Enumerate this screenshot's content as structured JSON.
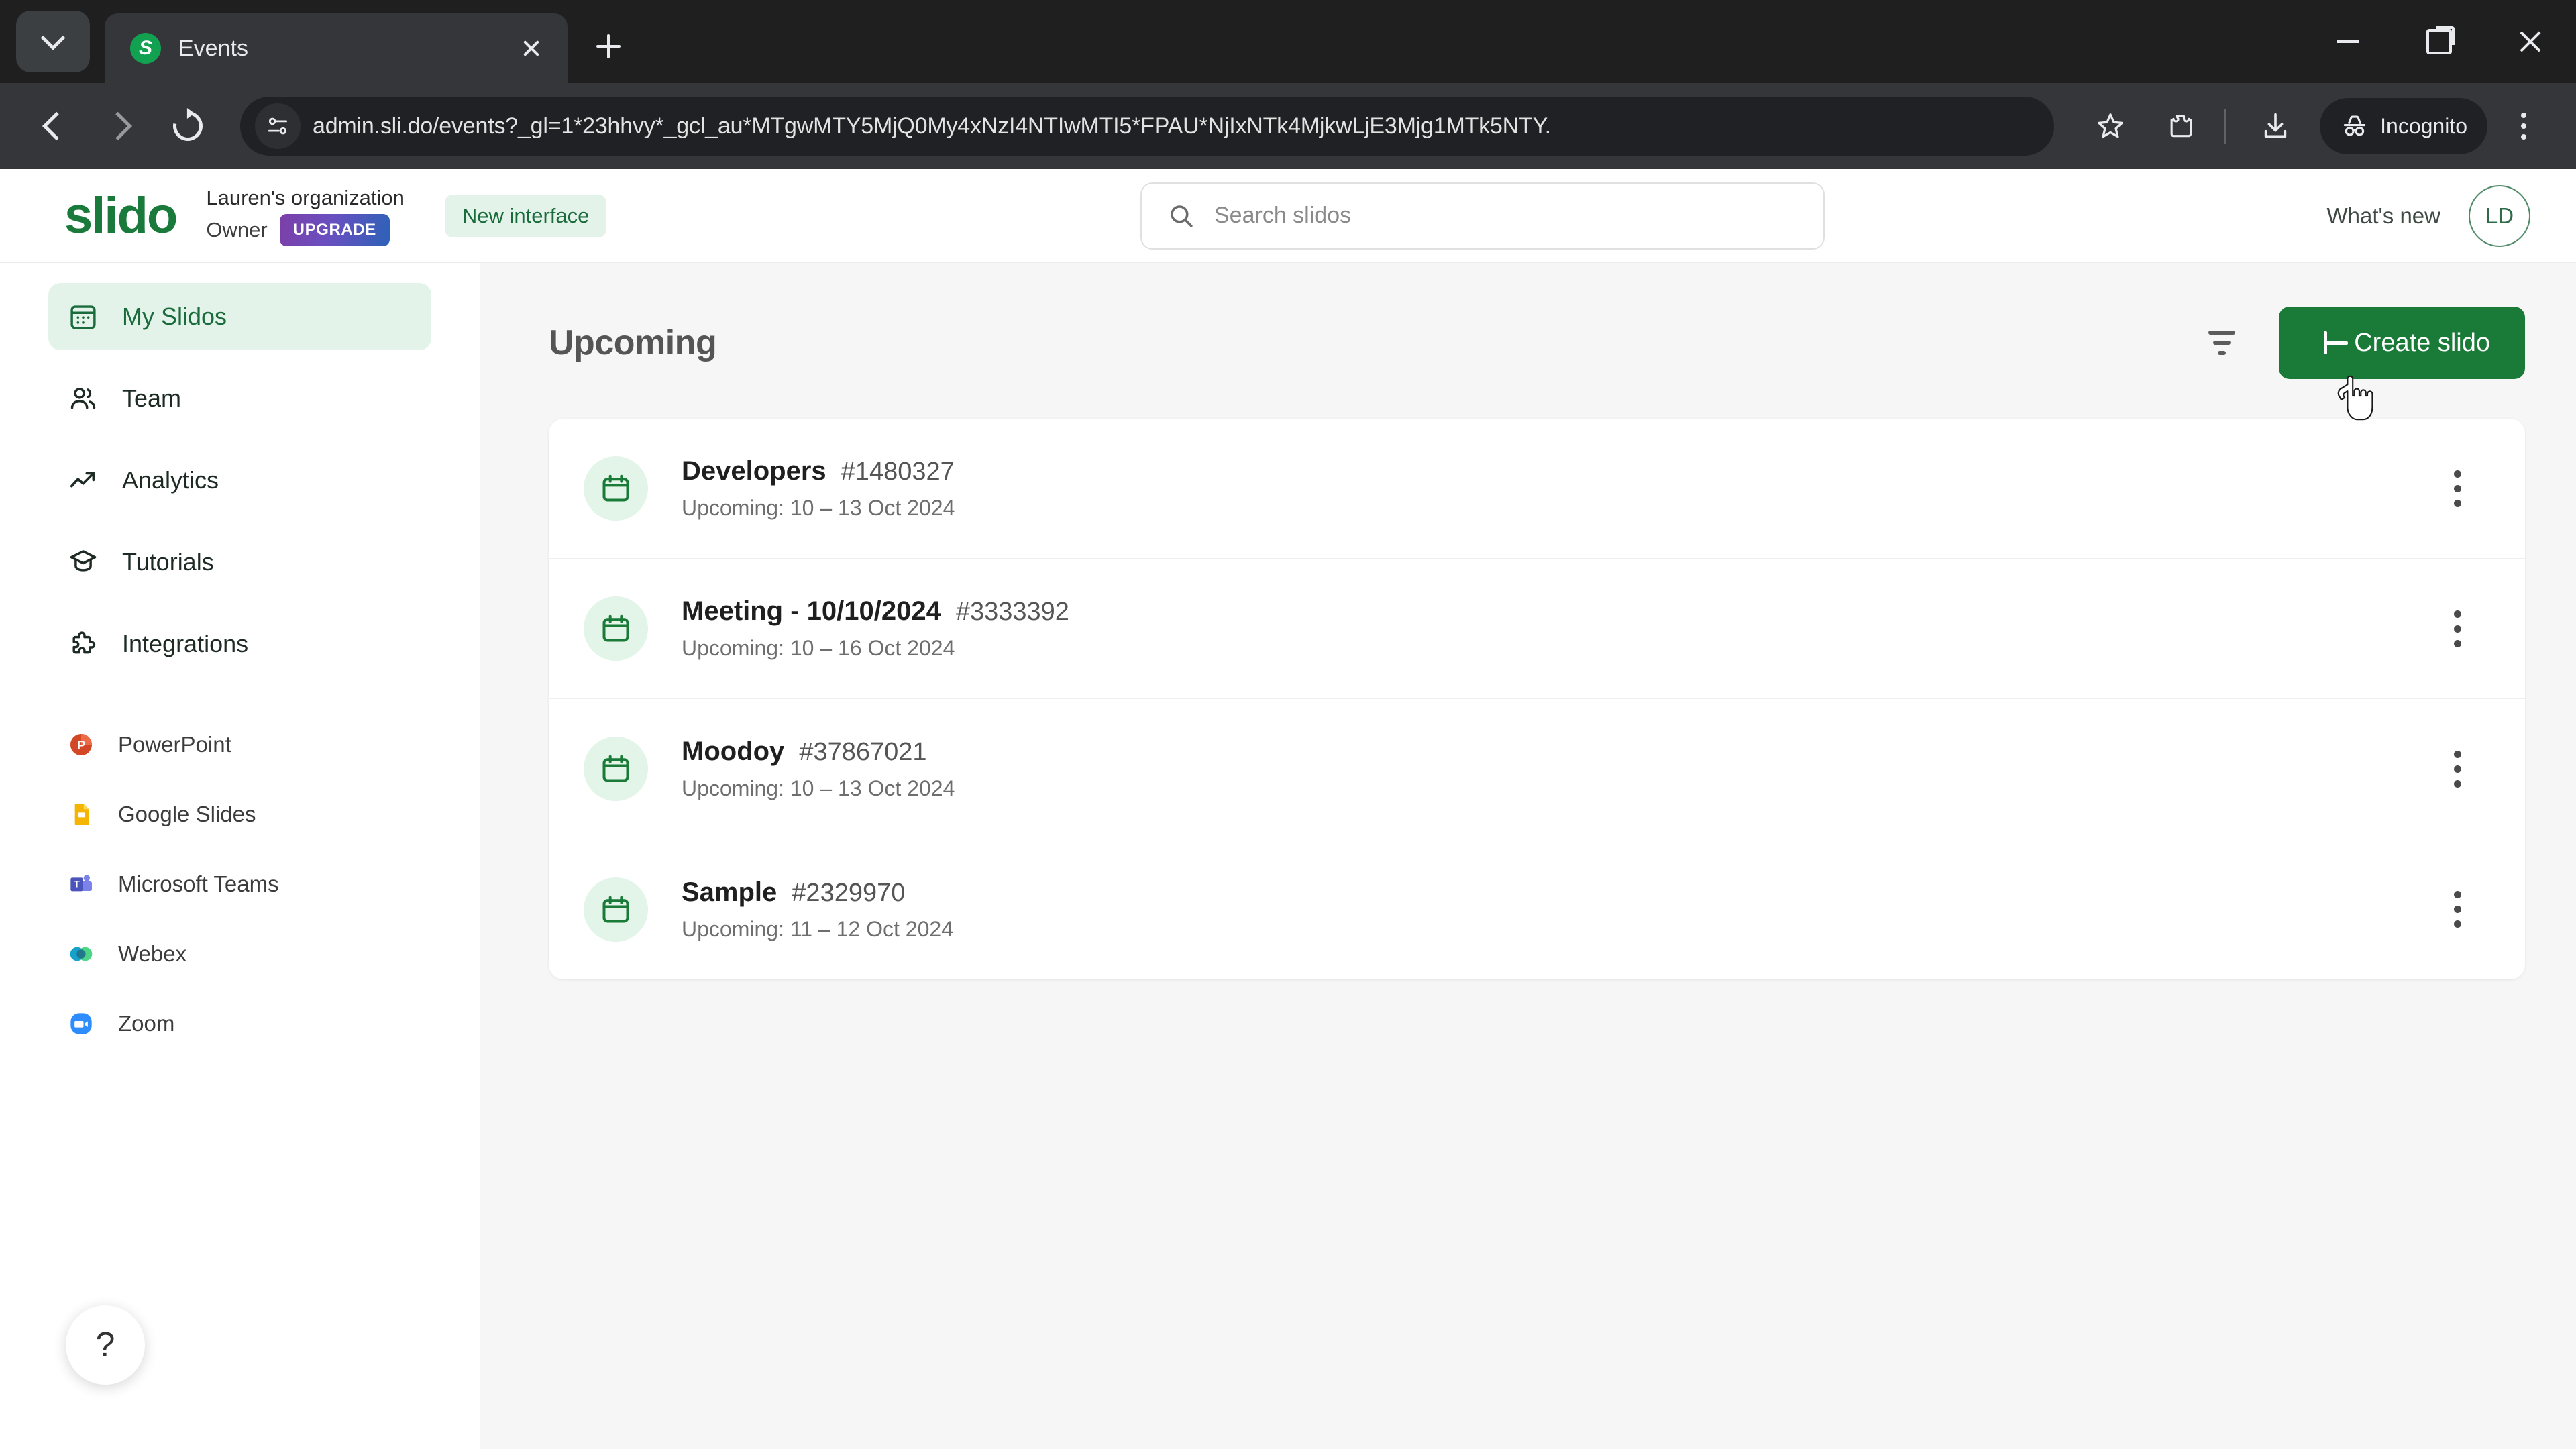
{
  "browser": {
    "tab": {
      "title": "Events",
      "favicon": "slido-s-favicon"
    },
    "url": "admin.sli.do/events?_gl=1*23hhvy*_gcl_au*MTgwMTY5MjQ0My4xNzI4NTIwMTI5*FPAU*NjIxNTk4MjkwLjE3Mjg1MTk5NTY.",
    "profile_label": "Incognito",
    "controls": {
      "tab_list": "tab-list-chevron",
      "new_tab": "new-tab",
      "close_tab": "close-tab",
      "back": "back",
      "forward": "forward",
      "reload": "reload",
      "bookmark": "bookmark-star",
      "extensions": "extensions",
      "downloads": "downloads",
      "menu": "chrome-menu",
      "minimize": "minimize",
      "maximize": "maximize",
      "close_window": "close-window"
    }
  },
  "header": {
    "logo": "slido",
    "org_name": "Lauren's organization",
    "role": "Owner",
    "upgrade_label": "UPGRADE",
    "new_interface_label": "New interface",
    "whats_new_label": "What's new",
    "avatar_initials": "LD"
  },
  "search": {
    "placeholder": "Search slidos",
    "value": ""
  },
  "sidebar": {
    "nav": [
      {
        "label": "My Slidos",
        "icon": "calendar-grid-icon",
        "active": true
      },
      {
        "label": "Team",
        "icon": "people-icon",
        "active": false
      },
      {
        "label": "Analytics",
        "icon": "trend-up-icon",
        "active": false
      },
      {
        "label": "Tutorials",
        "icon": "graduation-cap-icon",
        "active": false
      },
      {
        "label": "Integrations",
        "icon": "puzzle-piece-icon",
        "active": false
      }
    ],
    "integrations": [
      {
        "label": "PowerPoint",
        "icon": "powerpoint-icon",
        "color": "#D24726"
      },
      {
        "label": "Google Slides",
        "icon": "google-slides-icon",
        "color": "#F4B400"
      },
      {
        "label": "Microsoft Teams",
        "icon": "microsoft-teams-icon",
        "color": "#4B53BC"
      },
      {
        "label": "Webex",
        "icon": "webex-icon",
        "color": "#16A1C9"
      },
      {
        "label": "Zoom",
        "icon": "zoom-icon",
        "color": "#2D8CFF"
      }
    ],
    "help_label": "?"
  },
  "main": {
    "title": "Upcoming",
    "filter_icon": "filter-icon",
    "create_label": "Create slido",
    "events": [
      {
        "name": "Developers",
        "code": "#1480327",
        "status": "Upcoming: 10 – 13 Oct 2024"
      },
      {
        "name": "Meeting - 10/10/2024",
        "code": "#3333392",
        "status": "Upcoming: 10 – 16 Oct 2024"
      },
      {
        "name": "Moodoy",
        "code": "#37867021",
        "status": "Upcoming: 10 – 13 Oct 2024"
      },
      {
        "name": "Sample",
        "code": "#2329970",
        "status": "Upcoming: 11 – 12 Oct 2024"
      }
    ]
  },
  "colors": {
    "brand_green": "#1a7a38",
    "accent_light_green": "#e4f3ea",
    "page_bg": "#f6f6f6"
  }
}
